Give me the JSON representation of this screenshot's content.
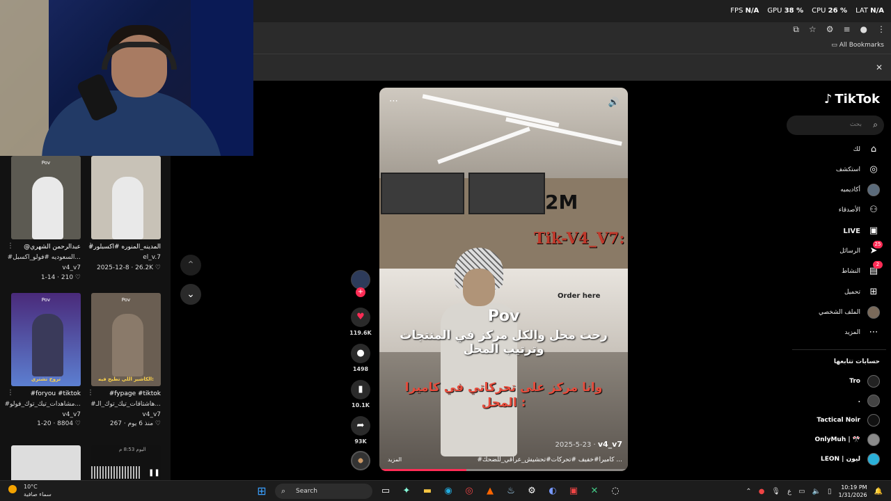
{
  "perf": {
    "fps_label": "FPS",
    "fps_val": "N/A",
    "gpu_label": "GPU",
    "gpu_val": "38 %",
    "cpu_label": "CPU",
    "cpu_val": "26 %",
    "lat_label": "LAT",
    "lat_val": "N/A"
  },
  "browser": {
    "all_bookmarks": "All Bookmarks"
  },
  "feed": {
    "cards": [
      {
        "cap_top": "Pov",
        "cap": "",
        "line1": "@عبدالرحمن الشهري",
        "line2": "#السعوديه #فولو_اكسبل...",
        "line3": "v4_v7",
        "line4": "1-14 · 210 ♡"
      },
      {
        "cap_top": "",
        "cap": "",
        "line1": "#المدينه_المنوره #اكسبلور",
        "line2": "el_v.7",
        "line3": "2025-12-8 · 26.2K ♡",
        "line4": ""
      },
      {
        "cap_top": "Pov",
        "cap": "تروح تشتري",
        "line1": "#foryou #tiktok",
        "line2": "#مشاهدات_تيك_توك_فولو...",
        "line3": "v4_v7",
        "line4": "1-20 · 8804 ♡"
      },
      {
        "cap_top": "Pov",
        "cap": "الكاشير اللي تطيح فيه:",
        "line1": "#fypage #tiktok",
        "line2": "#هاشتاقات_تيك_توك_الـ...",
        "line3": "v4_v7",
        "line4": "منذ 6 يوم · 267 ♡"
      }
    ],
    "partial_time": "اليوم 8:53 م"
  },
  "video": {
    "watermark": "Tik-V4_V7:",
    "sign": "2M",
    "order_here": "Order here",
    "pov": "Pov",
    "line1a": "رحت محل والكل مركز في المنتجات",
    "line1b": "وترتيب المحل",
    "line2a": "وانا مركز على تحركاتي في كاميرا",
    "line2b": "المحل :",
    "username": "v4_v7",
    "date": "2025-5-23 · ",
    "caption": "#كاميرا#خفيف #تحركات#تحشيش_عراقي_للضحك ...",
    "more": "المزيد",
    "progress": 0.35
  },
  "actions": {
    "likes": "119.6K",
    "comments": "1498",
    "saves": "10.1K",
    "shares": "93K"
  },
  "sidebar": {
    "logo": "TikTok",
    "search_placeholder": "بحث",
    "nav": {
      "foryou": "لك",
      "explore": "استكشف",
      "academy": "أكاديميه",
      "friends": "الأصدقاء",
      "live": "LIVE",
      "messages": "الرسائل",
      "messages_badge": "25",
      "activity": "النشاط",
      "activity_badge": "2",
      "upload": "تحميل",
      "profile": "الملف الشخصي",
      "more": "المزيد"
    },
    "following_title": "حسابات تتابعها",
    "following": [
      "Tro",
      ".",
      "Tactical Noir",
      "OnlyMuh | 🎌",
      "LEON | ليون"
    ]
  },
  "taskbar": {
    "temp": "10°C",
    "weather": "سماء صافية",
    "search": "Search",
    "time": "10:19 PM",
    "date": "1/31/2026",
    "lang": "ع"
  }
}
